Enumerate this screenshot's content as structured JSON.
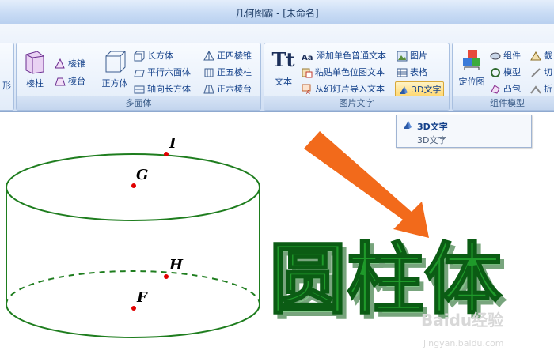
{
  "window": {
    "title": "几何图霸 - [未命名]"
  },
  "ribbon": {
    "partial_left_label": "形",
    "polyhedron_group": {
      "title": "多面体",
      "prism": "棱柱",
      "pyramid": "棱锥",
      "frustum": "棱台",
      "cube": "正方体",
      "cuboid": "长方体",
      "parallelepiped": "平行六面体",
      "axial_cuboid": "轴向长方体",
      "square_pyramid": "正四棱锥",
      "pentagonal_prism": "正五棱柱",
      "hexagonal_frustum": "正六棱台"
    },
    "image_text_group": {
      "title": "图片文字",
      "text": "文本",
      "text_icon": "Tt",
      "add_mono_text": "添加单色普通文本",
      "add_mono_text_icon": "Aa",
      "paste_mono_bitmap": "粘贴单色位图文本",
      "import_ppt_text": "从幻灯片导入文本",
      "image": "图片",
      "table": "表格",
      "text_3d": "3D文字"
    },
    "component_group": {
      "title": "组件模型",
      "position_map": "定位图",
      "component": "组件",
      "model": "模型",
      "convex_hull": "凸包",
      "cut_partial": "截",
      "slice_partial": "切",
      "fold_partial": "折"
    }
  },
  "tooltip": {
    "title": "3D文字",
    "description": "3D文字"
  },
  "canvas": {
    "points": [
      "I",
      "G",
      "H",
      "F"
    ],
    "text_3d": "圆柱体",
    "watermark_main": "Baidu经验",
    "watermark_url": "jingyan.baidu.com",
    "colors": {
      "cylinder": "#1e7d1e",
      "point": "#e00000",
      "arrow": "#f26a1b",
      "text_3d": "#1f9a2a"
    }
  }
}
